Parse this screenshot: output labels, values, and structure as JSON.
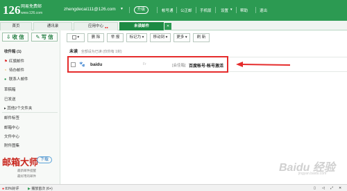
{
  "header": {
    "logo": "126",
    "logo_caption": "网易免费邮",
    "logo_url_text": "www.126.com",
    "account": "zhengdecai111@126.com",
    "upgrade": "升级",
    "links": [
      "帐号通",
      "公正邮",
      "手机版",
      "设置",
      "帮助",
      "退出"
    ]
  },
  "tabs": [
    {
      "label": "首页"
    },
    {
      "label": "通讯录"
    },
    {
      "label": "应用中心"
    },
    {
      "label": "未读邮件",
      "active": true
    }
  ],
  "sidebar": {
    "receive": "收 信",
    "write": "写 信",
    "items": [
      {
        "label": "收件箱 (1)",
        "bold": true
      },
      {
        "label": "红旗邮件",
        "icon": "red-flag-icon"
      },
      {
        "label": "待办邮件",
        "icon": "todo-icon"
      },
      {
        "label": "联系人邮件",
        "icon": "contact-icon"
      },
      {
        "label": "草稿箱"
      },
      {
        "label": "已发送"
      },
      {
        "label": "其他2个文件夹"
      },
      {
        "label": "邮件标签"
      },
      {
        "label": "邮箱中心"
      },
      {
        "label": "文件中心"
      },
      {
        "label": "附件图集"
      }
    ],
    "promo_title": "邮箱大师",
    "promo_download": "下载",
    "promo_lines": [
      "最新邮件提醒",
      "最好用的邮件"
    ]
  },
  "toolbar": {
    "buttons": [
      "删 除",
      "举 报",
      "标记为",
      "移动到",
      "更多",
      "刷 新"
    ]
  },
  "list": {
    "title": "未读",
    "subtitle": "全部设为已读  (仅你有 1封)"
  },
  "mail": {
    "sender": "baidu",
    "forward_mark": "Fr",
    "tag": "[会佳箱]",
    "subject": "百度帐号-帐号激活"
  },
  "statusbar": {
    "items": [
      "83%好评",
      "播放首次 (6+)"
    ]
  },
  "watermark": {
    "text": "Baidu 经验",
    "sub": "jingyan.baidu.com"
  },
  "colors": {
    "brand_green": "#2c9a52",
    "highlight_red": "#e52b2b"
  }
}
